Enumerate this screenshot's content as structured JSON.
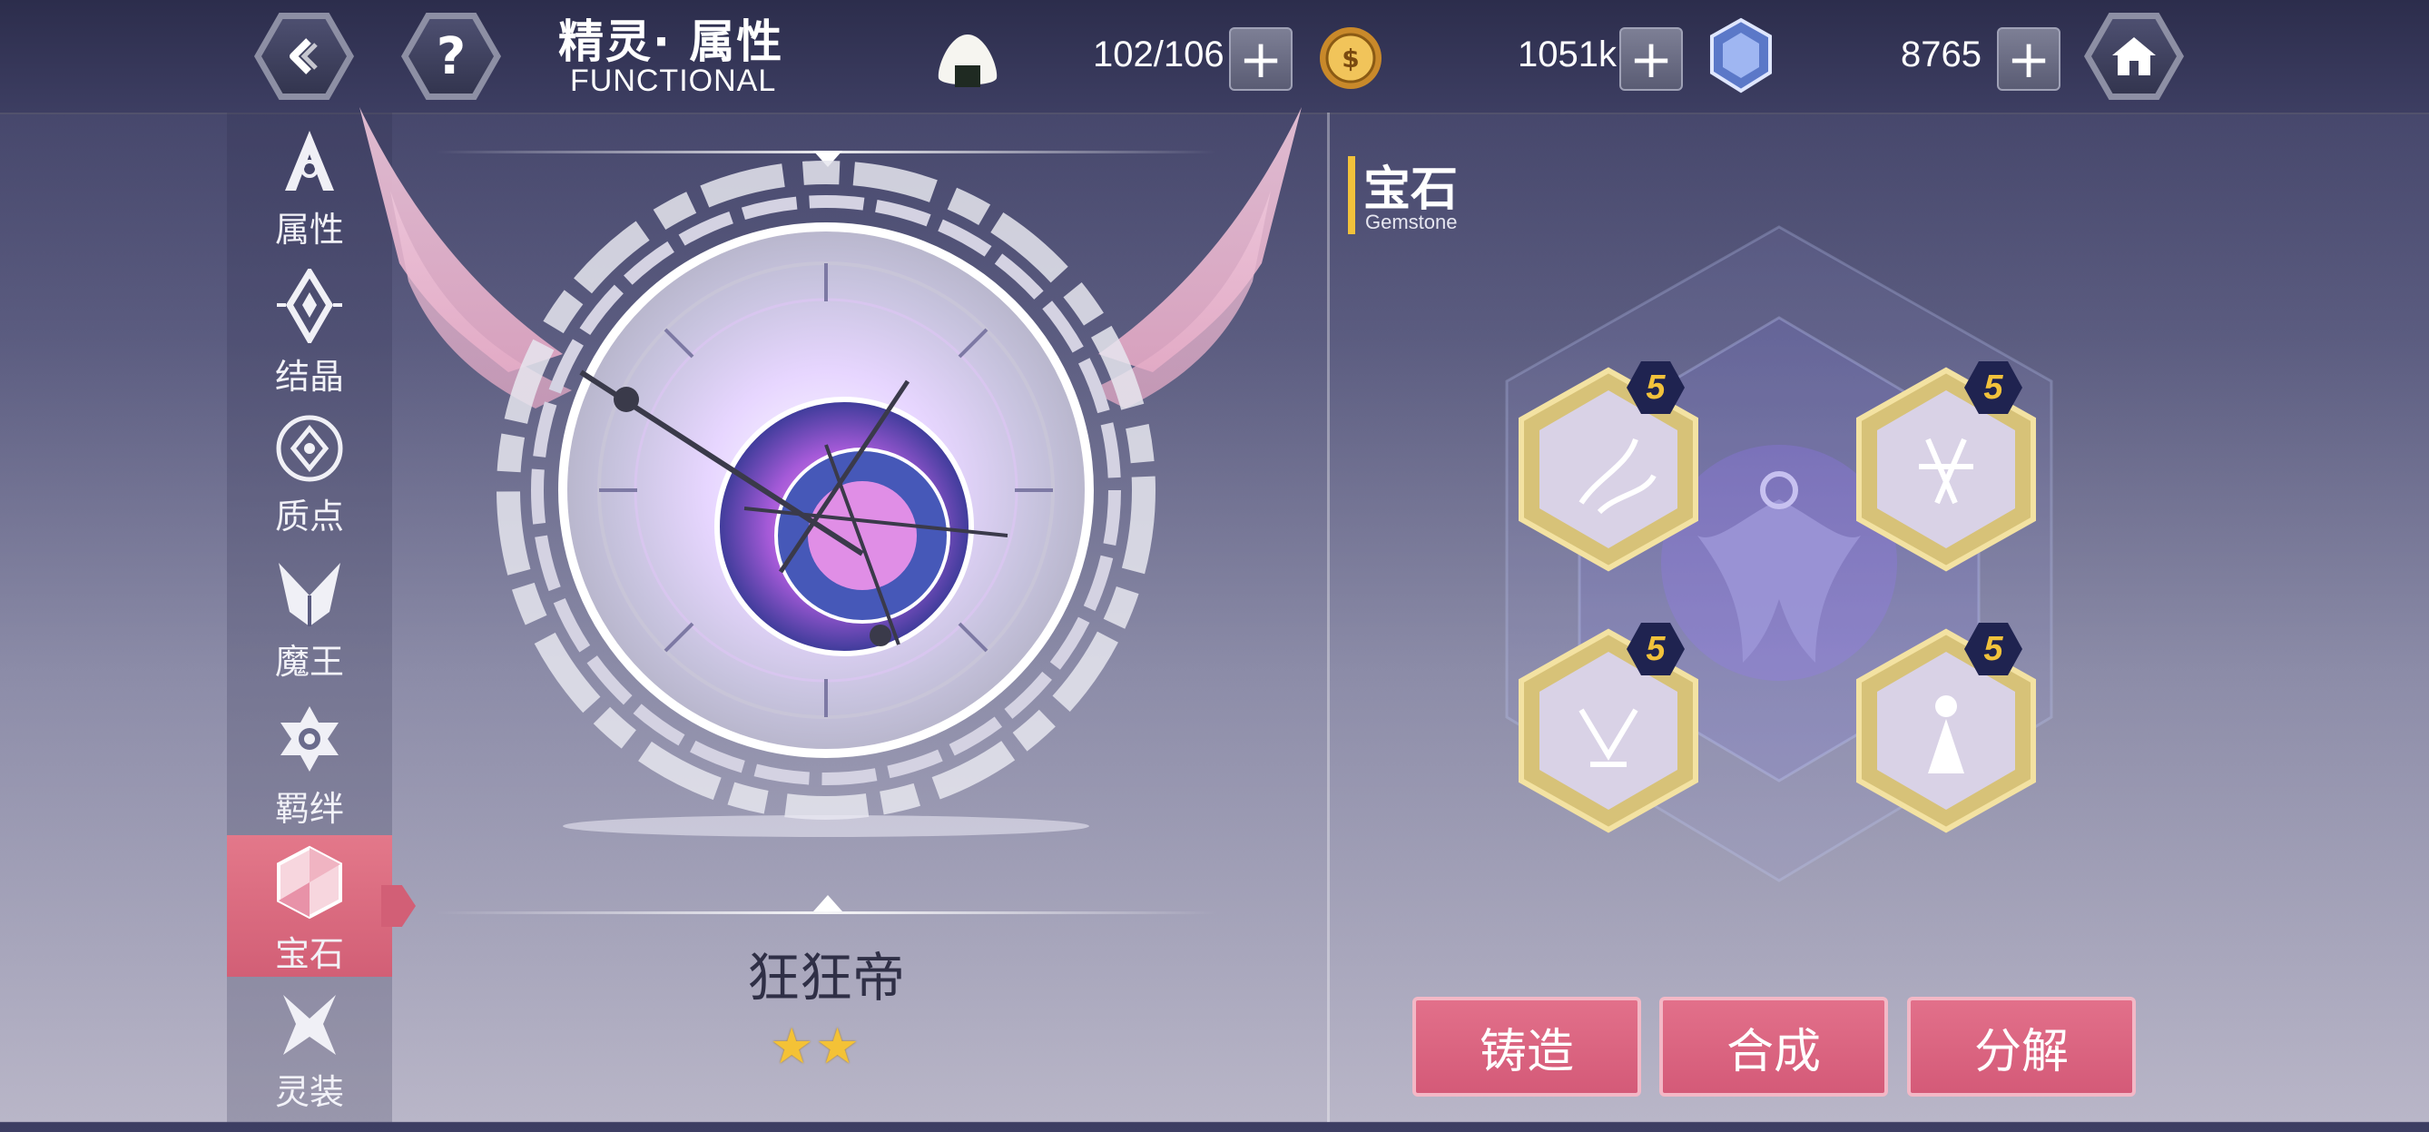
{
  "header": {
    "title_cn": "精灵· 属性",
    "title_en": "FUNCTIONAL",
    "back_icon": "back-arrow-icon",
    "help_icon": "question-icon",
    "home_icon": "home-icon"
  },
  "resources": {
    "stamina": {
      "value": "102/106",
      "icon": "rice-ball-icon"
    },
    "gold": {
      "value": "1051k",
      "icon": "gold-coin-icon"
    },
    "crystal": {
      "value": "8765",
      "icon": "crystal-icon"
    }
  },
  "sidebar": {
    "items": [
      {
        "label": "属性",
        "icon": "attribute-a-icon"
      },
      {
        "label": "结晶",
        "icon": "crystal-diamond-icon"
      },
      {
        "label": "质点",
        "icon": "sephira-icon"
      },
      {
        "label": "魔王",
        "icon": "demon-king-icon"
      },
      {
        "label": "羁绊",
        "icon": "bond-flower-icon"
      },
      {
        "label": "宝石",
        "icon": "gemstone-icon",
        "active": true
      },
      {
        "label": "灵装",
        "icon": "astral-dress-icon"
      }
    ]
  },
  "character": {
    "name": "狂狂帝",
    "stars": 2
  },
  "gem_panel": {
    "title": "宝石",
    "subtitle": "Gemstone",
    "slots": [
      {
        "level": "5",
        "icon": "gem-slot-icon"
      },
      {
        "level": "5",
        "icon": "gem-slot-icon"
      },
      {
        "level": "5",
        "icon": "gem-slot-icon"
      },
      {
        "level": "5",
        "icon": "gem-slot-icon"
      }
    ]
  },
  "actions": {
    "forge": "铸造",
    "synthesize": "合成",
    "decompose": "分解"
  },
  "colors": {
    "accent_pink": "#d45a78",
    "gold": "#f2c23b"
  }
}
